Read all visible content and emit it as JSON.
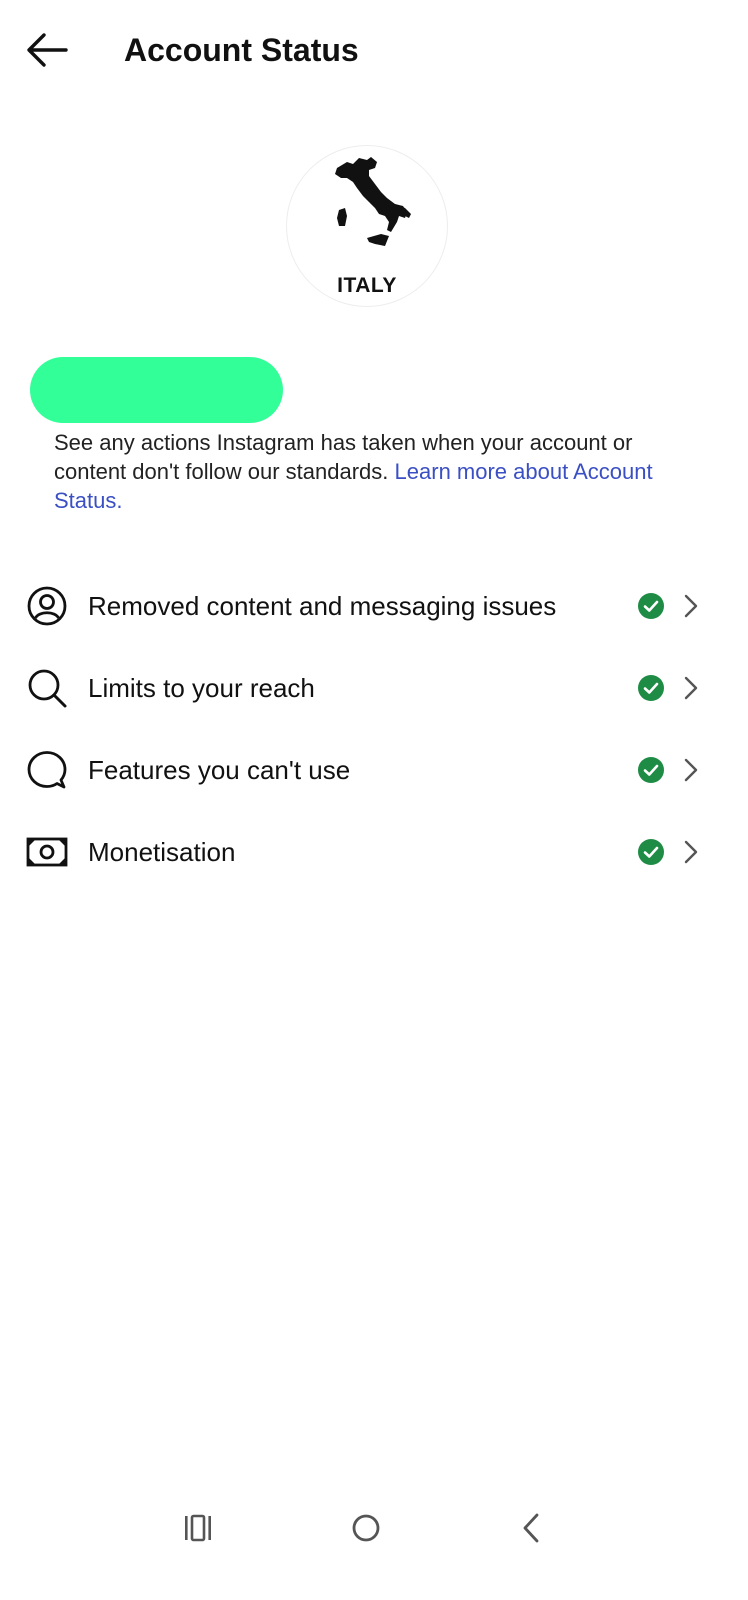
{
  "header": {
    "title": "Account Status",
    "back_icon": "arrow-left-icon"
  },
  "profile": {
    "avatar_label": "ITALY",
    "avatar_image": "italy-map-silhouette",
    "username_redacted": true,
    "redaction_color": "#33ff99"
  },
  "description": {
    "text": "See any actions Instagram has taken when your account or content don't follow our standards. ",
    "link_text": "Learn more about Account Status."
  },
  "status_items": [
    {
      "label": "Removed content and messaging issues",
      "icon": "user-circle-icon",
      "status": "ok"
    },
    {
      "label": "Limits to your reach",
      "icon": "search-icon",
      "status": "ok"
    },
    {
      "label": "Features you can't use",
      "icon": "speech-bubble-icon",
      "status": "ok"
    },
    {
      "label": "Monetisation",
      "icon": "banknote-icon",
      "status": "ok"
    }
  ],
  "colors": {
    "status_ok": "#1e8c45",
    "link": "#3a4fc4",
    "text": "#111111"
  },
  "navbar": {
    "recents_icon": "recent-apps-icon",
    "home_icon": "home-circle-icon",
    "back_icon": "nav-back-icon"
  }
}
